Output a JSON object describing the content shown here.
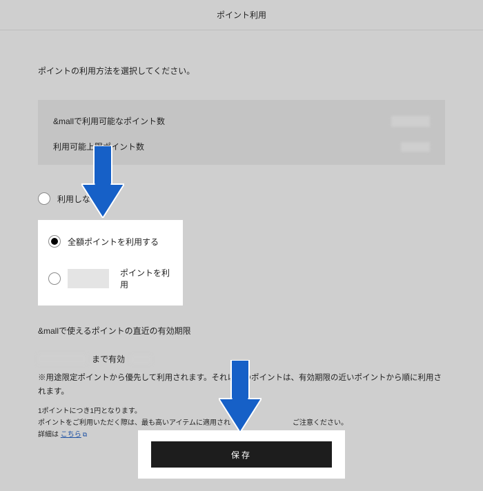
{
  "header": {
    "title": "ポイント利用"
  },
  "instruction": "ポイントの利用方法を選択してください。",
  "points_box": {
    "available_label": "&mallで利用可能なポイント数",
    "limit_label": "利用可能上限ポイント数"
  },
  "options": {
    "none_label": "利用しない",
    "all_label": "全額ポイントを利用する",
    "partial_suffix": "ポイントを利用"
  },
  "expiry": {
    "heading": "&mallで使えるポイントの直近の有効期限",
    "until_label": "まで有効"
  },
  "notes": {
    "priority": "※用途限定ポイントから優先して利用されます。それ以外のポイントは、有効期限の近いポイントから順に利用されます。",
    "rate": "1ポイントにつき1円となります。",
    "apply_prefix": "ポイントをご利用いただく際は、最も高いアイテムに適用され",
    "apply_suffix": "ご注意ください。",
    "detail_prefix": "詳細は",
    "detail_link": "こちら"
  },
  "save": {
    "label": "保存"
  }
}
